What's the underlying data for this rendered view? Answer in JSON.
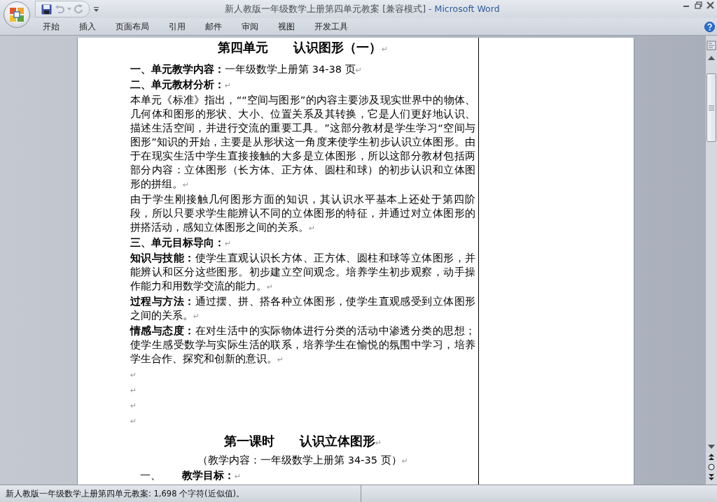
{
  "window": {
    "title": "新人教版一年级数学上册第四单元教案 [兼容模式]",
    "app_name": "- Microsoft Word"
  },
  "ribbon_tabs": [
    {
      "label": "开始",
      "selected": false
    },
    {
      "label": "插入",
      "selected": false
    },
    {
      "label": "页面布局",
      "selected": false
    },
    {
      "label": "引用",
      "selected": false
    },
    {
      "label": "邮件",
      "selected": false
    },
    {
      "label": "审阅",
      "selected": false
    },
    {
      "label": "视图",
      "selected": false
    },
    {
      "label": "开发工具",
      "selected": false
    }
  ],
  "document": {
    "paragraphs": [
      {
        "kind": "title",
        "text": "第四单元　　认识图形（一）",
        "mark": "↵"
      },
      {
        "kind": "body",
        "text": "**一、单元教学内容：**一年级数学上册第 34-38 页",
        "mark": "↵"
      },
      {
        "kind": "heading",
        "text": "二、单元教材分析：",
        "mark": "↵"
      },
      {
        "kind": "body",
        "text": "本单元《标准》指出，““空间与图形”的内容主要涉及现实世界中的物体、几何体和图形的形状、大小、位置关系及其转换，它是人们更好地认识、描述生活空间，并进行交流的重要工具。”这部分教材是学生学习“空间与图形”知识的开始，主要是从形状这一角度来使学生初步认识立体图形。由于在现实生活中学生直接接触的大多是立体图形，所以这部分教材包括两部分内容：立体图形（长方体、正方体、圆柱和球）的初步认识和立体图形的拼组。",
        "mark": "↵"
      },
      {
        "kind": "body",
        "text": "由于学生刚接触几何图形方面的知识，其认识水平基本上还处于第四阶段，所以只要求学生能辨认不同的立体图形的特征，并通过对立体图形的拼搭活动，感知立体图形之间的关系。",
        "mark": "↵"
      },
      {
        "kind": "heading",
        "text": "三、单元目标导向：",
        "mark": "↵"
      },
      {
        "kind": "body",
        "text": "**知识与技能：**使学生直观认识长方体、正方体、圆柱和球等立体图形，并能辨认和区分这些图形。初步建立空间观念。培养学生初步观察，动手操作能力和用数学交流的能力。",
        "mark": "↵"
      },
      {
        "kind": "body",
        "text": "**过程与方法：**通过摆、拼、搭各种立体图形，使学生直观感受到立体图形之间的关系。",
        "mark": "↵"
      },
      {
        "kind": "body",
        "text": "**情感与态度：**在对生活中的实际物体进行分类的活动中渗透分类的思想；使学生感受数学与实际生活的联系，培养学生在愉悦的氛围中学习，培养学生合作、探究和创新的意识。",
        "mark": "↵"
      },
      {
        "kind": "empty",
        "mark": "↵"
      },
      {
        "kind": "empty",
        "mark": "↵"
      },
      {
        "kind": "empty",
        "mark": "↵"
      },
      {
        "kind": "empty",
        "mark": "↵"
      },
      {
        "kind": "title",
        "text": "第一课时　　认识立体图形",
        "mark": "↵"
      },
      {
        "kind": "subtitle",
        "text": "（教学内容：一年级数学上册第 34-35 页）",
        "mark": "↵"
      },
      {
        "kind": "list",
        "text": "一、　　**教学目标：**",
        "mark": "↵"
      }
    ]
  },
  "status_bar": {
    "text": "新人教版一年级数学上册第四单元教案: 1,698 个字符(近似值)。"
  }
}
